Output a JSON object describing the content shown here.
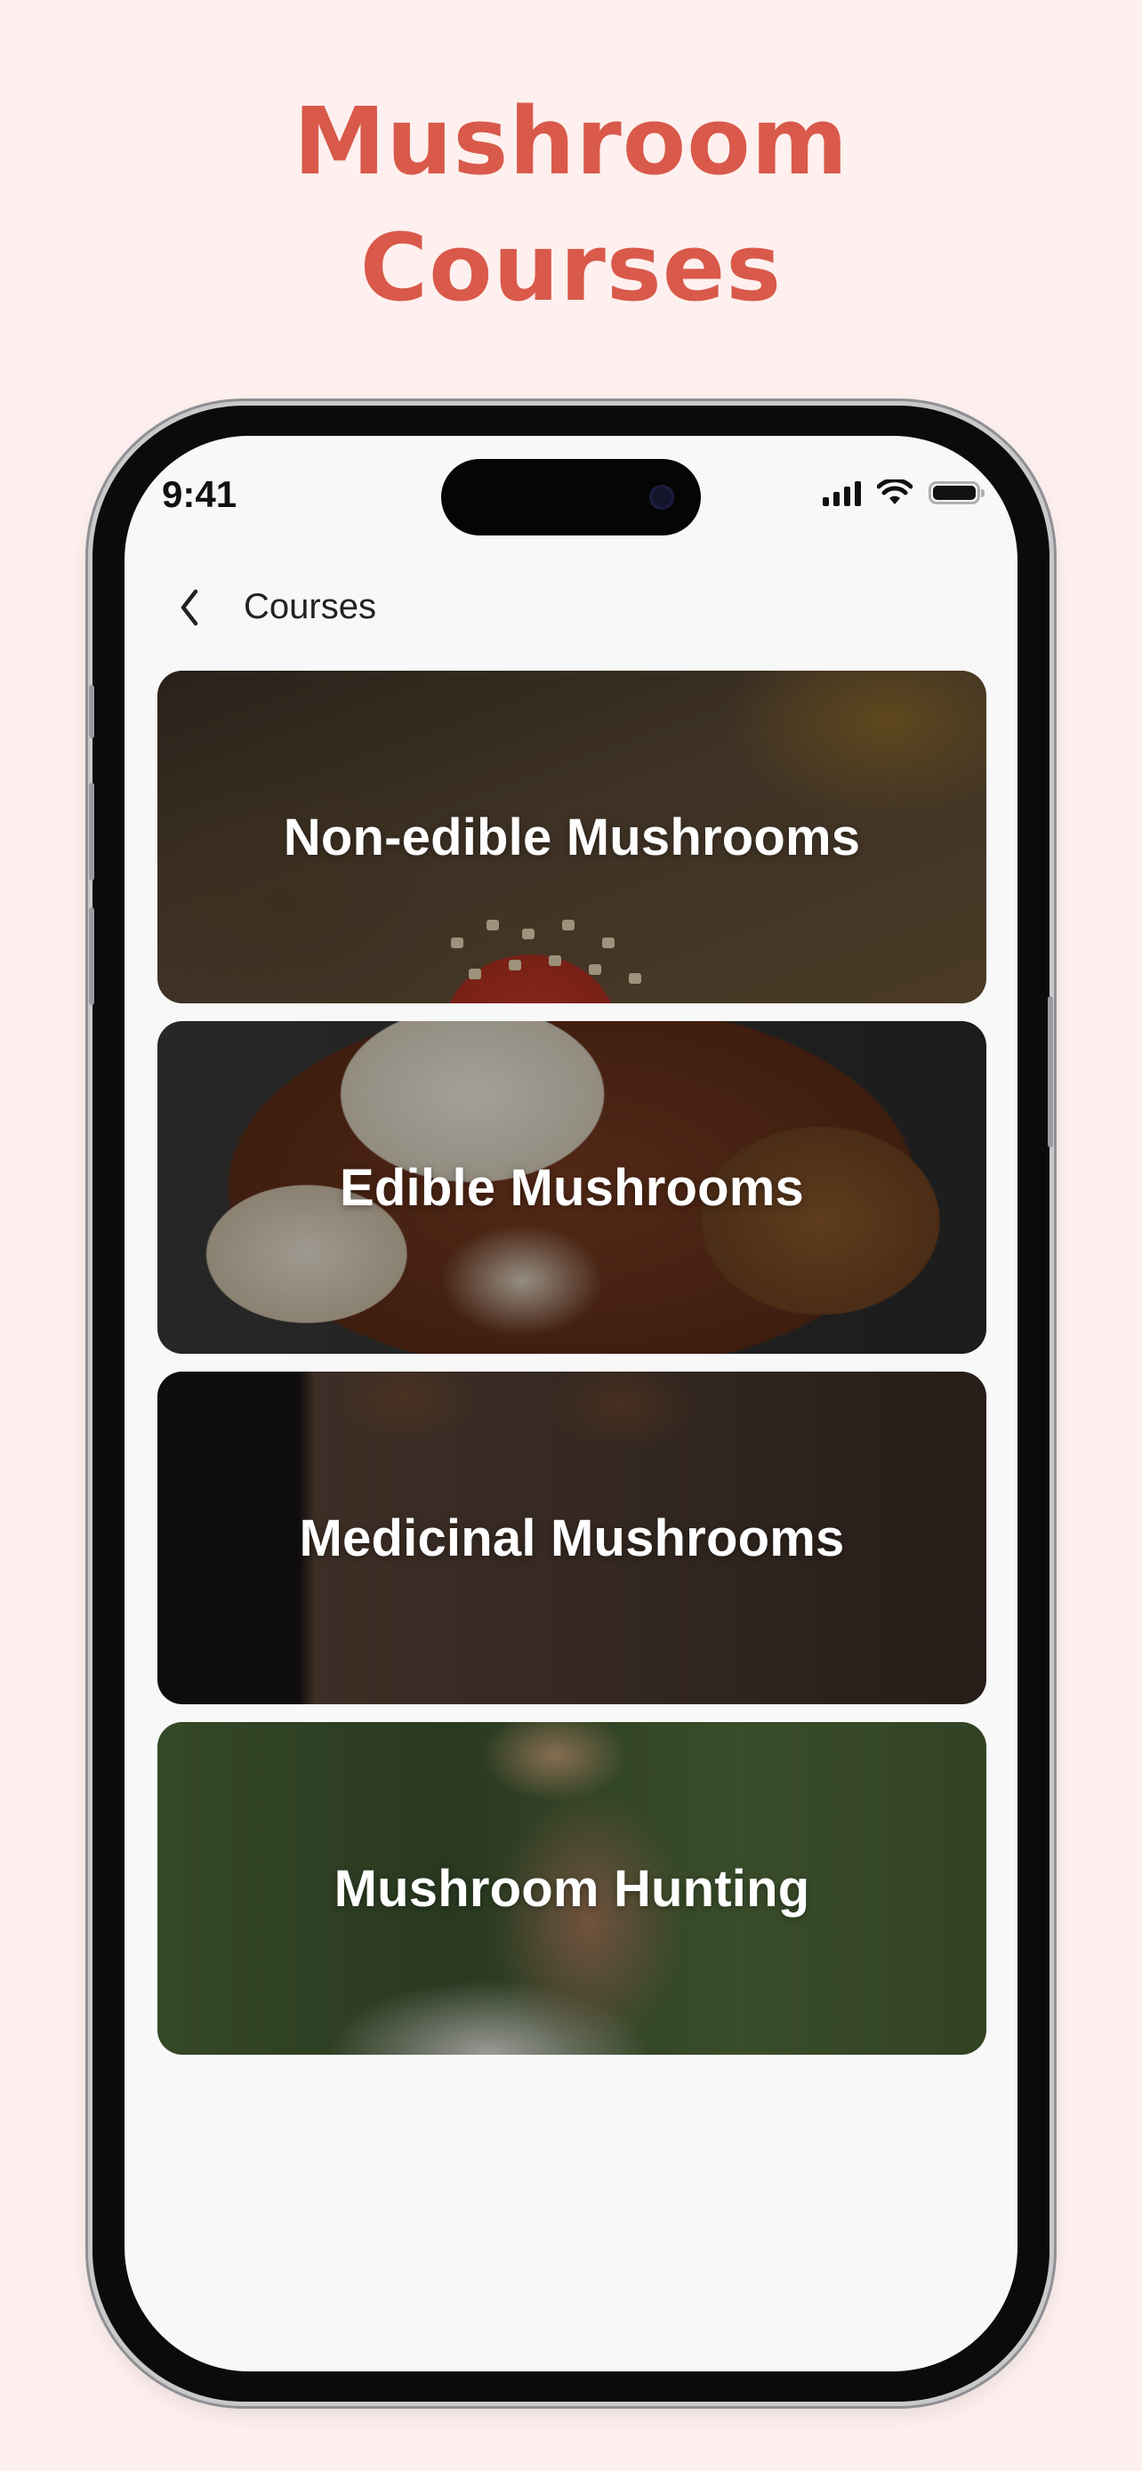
{
  "promo": {
    "headline_line1": "Mushroom",
    "headline_line2": "Courses",
    "accent_color": "#d9594a",
    "background_color": "#fdf0ee"
  },
  "status_bar": {
    "time": "9:41",
    "icons": [
      "cellular-signal-icon",
      "wifi-icon",
      "battery-icon"
    ]
  },
  "nav": {
    "back_icon": "chevron-left-icon",
    "title": "Courses"
  },
  "courses": [
    {
      "title": "Non-edible Mushrooms"
    },
    {
      "title": "Edible Mushrooms"
    },
    {
      "title": "Medicinal Mushrooms"
    },
    {
      "title": "Mushroom Hunting"
    }
  ]
}
